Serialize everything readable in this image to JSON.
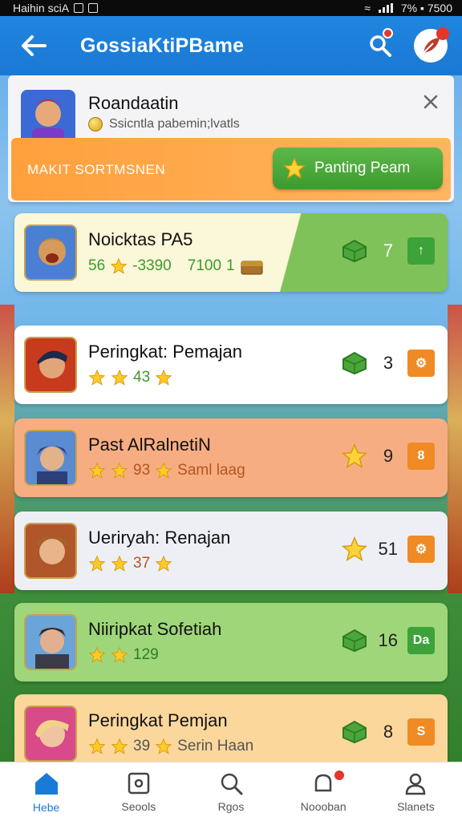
{
  "status_bar": {
    "left_text": "Haihin sciA",
    "right_text": "7% ▪ 7500"
  },
  "app_bar": {
    "title": "GossiaKtiPBame"
  },
  "header_card": {
    "title": "Roandaatin",
    "subtitle": "Ssicntla pabemin;lvatls",
    "banner_text": "MAKIT SORTMSNEN",
    "primary_button": "Panting Peam"
  },
  "rows": [
    {
      "name": "Noicktas PA5",
      "meta": [
        "56",
        "-3390",
        "7100",
        "1"
      ],
      "score": "7",
      "action_glyph": "↑",
      "score_icon": "gem-icon",
      "action_color": "#3da23a"
    },
    {
      "name": "Peringkat: Pemajan",
      "meta": [
        "43"
      ],
      "score": "3",
      "action_glyph": "⚙",
      "score_icon": "gem-icon",
      "action_color": "#f08a24"
    },
    {
      "name": "Past AlRalnetiN",
      "meta": [
        "93",
        "Saml laag"
      ],
      "score": "9",
      "action_glyph": "8",
      "score_icon": "star-icon",
      "action_color": "#f08a24"
    },
    {
      "name": "Ueriryah: Renajan",
      "meta": [
        "37"
      ],
      "score": "51",
      "action_glyph": "⚙",
      "score_icon": "star-icon",
      "action_color": "#f08a24"
    },
    {
      "name": "Niiripkat Sofetiah",
      "meta": [
        "129"
      ],
      "score": "16",
      "action_glyph": "Da",
      "score_icon": "gem-icon",
      "action_color": "#3da23a"
    },
    {
      "name": "Peringkat Pemjan",
      "meta": [
        "39",
        "Serin Haan"
      ],
      "score": "8",
      "action_glyph": "S",
      "score_icon": "gem-icon",
      "action_color": "#f08a24"
    }
  ],
  "bottom_nav": [
    {
      "label": "Hebe",
      "active": true
    },
    {
      "label": "Seools"
    },
    {
      "label": "Rgos"
    },
    {
      "label": "Noooban",
      "badge": true
    },
    {
      "label": "Slanets"
    }
  ],
  "colors": {
    "primary": "#1a7bd6",
    "accent_green": "#3da23a",
    "accent_orange": "#ffa03c",
    "alert": "#e4362b"
  }
}
